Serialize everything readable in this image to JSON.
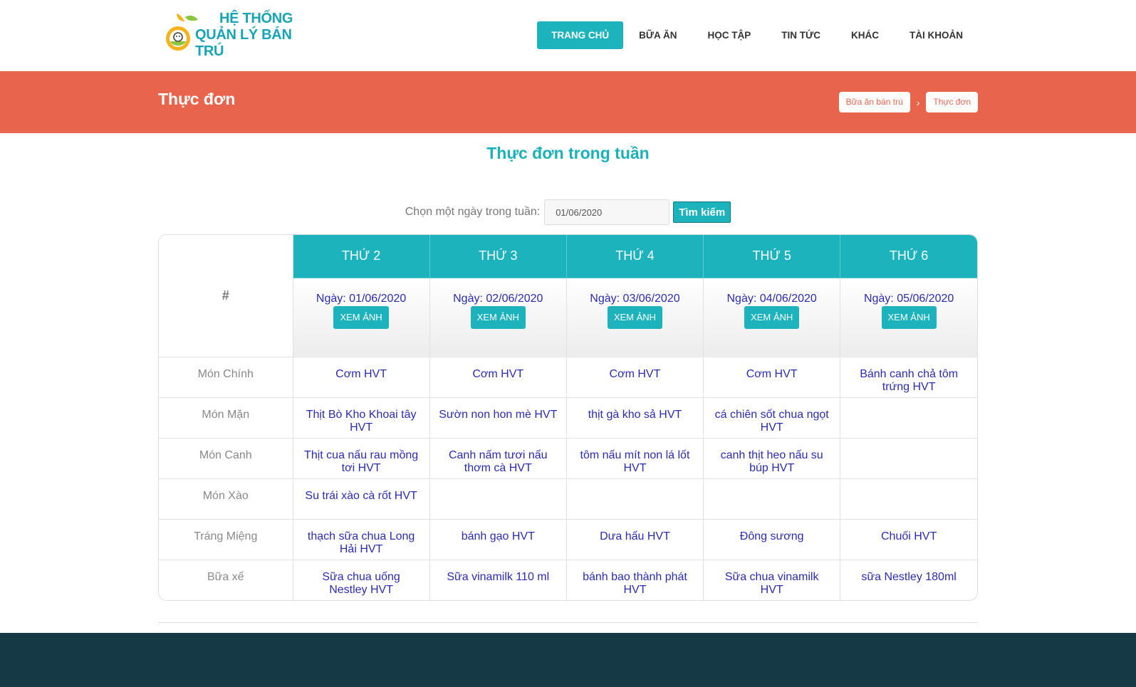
{
  "logo": {
    "line1": "HỆ THỐNG",
    "line2": "QUẢN LÝ BÁN TRÚ"
  },
  "nav": [
    "TRANG CHỦ",
    "BỮA ĂN",
    "HỌC TẬP",
    "TIN TỨC",
    "KHÁC",
    "TÀI KHOẢN"
  ],
  "banner": {
    "title": "Thực đơn",
    "breadcrumb": [
      "Bữa ăn bán trú",
      "Thực đơn"
    ],
    "separator": "›"
  },
  "main": {
    "title": "Thực đơn trong tuần",
    "search_label": "Chọn một ngày trong tuần:",
    "search_value": "01/06/2020",
    "search_button": "Tìm kiếm"
  },
  "table": {
    "corner": "#",
    "days": [
      "THỨ 2",
      "THỨ 3",
      "THỨ 4",
      "THỨ 5",
      "THỨ 6"
    ],
    "dates": [
      "Ngày: 01/06/2020",
      "Ngày: 02/06/2020",
      "Ngày: 03/06/2020",
      "Ngày: 04/06/2020",
      "Ngày: 05/06/2020"
    ],
    "view_button": "XEM ẢNH",
    "rows": [
      {
        "label": "Món Chính",
        "cells": [
          "Cơm HVT",
          "Cơm HVT",
          "Cơm HVT",
          "Cơm HVT",
          "Bánh canh chả tôm trứng HVT"
        ]
      },
      {
        "label": "Món Mặn",
        "cells": [
          "Thịt Bò Kho Khoai tây HVT",
          "Sườn non hon mè HVT",
          "thịt gà kho sả HVT",
          "cá chiên sốt chua ngọt HVT",
          ""
        ]
      },
      {
        "label": "Món Canh",
        "cells": [
          "Thịt cua nấu rau mồng tơi HVT",
          "Canh nấm tươi nấu thơm cà HVT",
          "tôm nấu mít non lá lốt HVT",
          "canh thịt heo nấu su búp HVT",
          ""
        ]
      },
      {
        "label": "Món Xào",
        "cells": [
          "Su trái xào cà rốt HVT",
          "",
          "",
          "",
          ""
        ]
      },
      {
        "label": "Tráng Miệng",
        "cells": [
          "thạch sữa chua Long Hải HVT",
          "bánh gạo HVT",
          "Dưa hấu HVT",
          "Đông sương",
          "Chuối HVT"
        ]
      },
      {
        "label": "Bữa xế",
        "cells": [
          "Sữa chua uống Nestley HVT",
          "Sữa vinamilk 110 ml",
          "bánh bao thành phát HVT",
          "Sữa chua vinamilk HVT",
          "sữa Nestley 180ml"
        ]
      }
    ]
  }
}
